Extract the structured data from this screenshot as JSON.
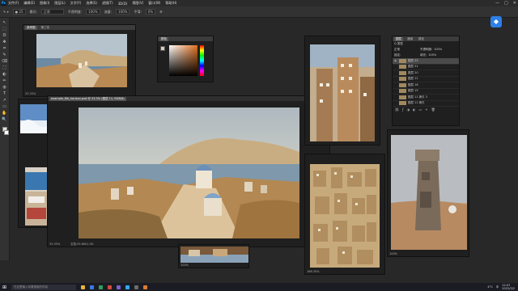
{
  "menubar": {
    "logo": "Ps",
    "items": [
      "文件(F)",
      "编辑(E)",
      "图像(I)",
      "图层(L)",
      "文字(Y)",
      "选择(S)",
      "滤镜(T)",
      "3D(D)",
      "视图(V)",
      "窗口(W)",
      "帮助(H)"
    ],
    "controls": [
      "—",
      "□",
      "✕"
    ]
  },
  "optbar": {
    "mode_label": "模式:",
    "mode_value": "正常",
    "opacity_label": "不透明度:",
    "opacity_value": "100%",
    "flow_label": "流量:",
    "flow_value": "100%",
    "smooth_label": "平滑:",
    "smooth_value": "0%"
  },
  "toolbar": {
    "tools": [
      "↖",
      "⬚",
      "ʘ",
      "✥",
      "⌗",
      "✎",
      "⌫",
      "⛶",
      "◐",
      "✏",
      "◍",
      "T",
      "↗",
      "▭",
      "✋",
      "🔍"
    ]
  },
  "windows": {
    "top_left": {
      "tabs": [
        "参考图",
        "第三张"
      ],
      "status": "33.33%"
    },
    "main": {
      "title": "example_file_horizon.psd @ 33.3% (图层 11, RGB/8)",
      "status": "33.33%",
      "doc_info": "文档:35.6M/1.9G"
    },
    "left_small": {
      "status": ""
    },
    "bottom_center": {
      "status": "100%"
    },
    "right_tall": {
      "status": ""
    },
    "right_bottom": {
      "status": "166.35%"
    },
    "far_right": {
      "status": "100%"
    }
  },
  "color_panel": {
    "title": "颜色"
  },
  "layers_panel": {
    "tabs": [
      "图层",
      "通道",
      "路径"
    ],
    "kind_label": "Q 类型",
    "blend_mode": "正常",
    "opacity_label": "不透明度:",
    "opacity_value": "100%",
    "lock_label": "锁定:",
    "fill_label": "填充:",
    "fill_value": "100%",
    "layers": [
      {
        "name": "图层 22",
        "selected": true
      },
      {
        "name": "图层 21",
        "selected": false
      },
      {
        "name": "图层 20",
        "selected": false
      },
      {
        "name": "图层 11",
        "selected": false
      },
      {
        "name": "图层 16",
        "selected": false
      },
      {
        "name": "图层 15",
        "selected": false
      },
      {
        "name": "图层 11 拷贝 3",
        "selected": false
      },
      {
        "name": "图层 11 拷贝",
        "selected": false
      }
    ]
  },
  "taskbar": {
    "start": "⊞",
    "search_placeholder": "在这里输入你要搜索的内容",
    "app_colors": [
      "#e8b339",
      "#3b7ae0",
      "#2f9e5b",
      "#d24b3c",
      "#7b5fd0",
      "#31a8ff",
      "#6b6b6b",
      "#e07b2f"
    ],
    "tray": {
      "temp": "4°C",
      "lang": "中",
      "time": "12:47",
      "date": "2022/3/2"
    }
  },
  "assistant": {
    "icon": "◆"
  }
}
